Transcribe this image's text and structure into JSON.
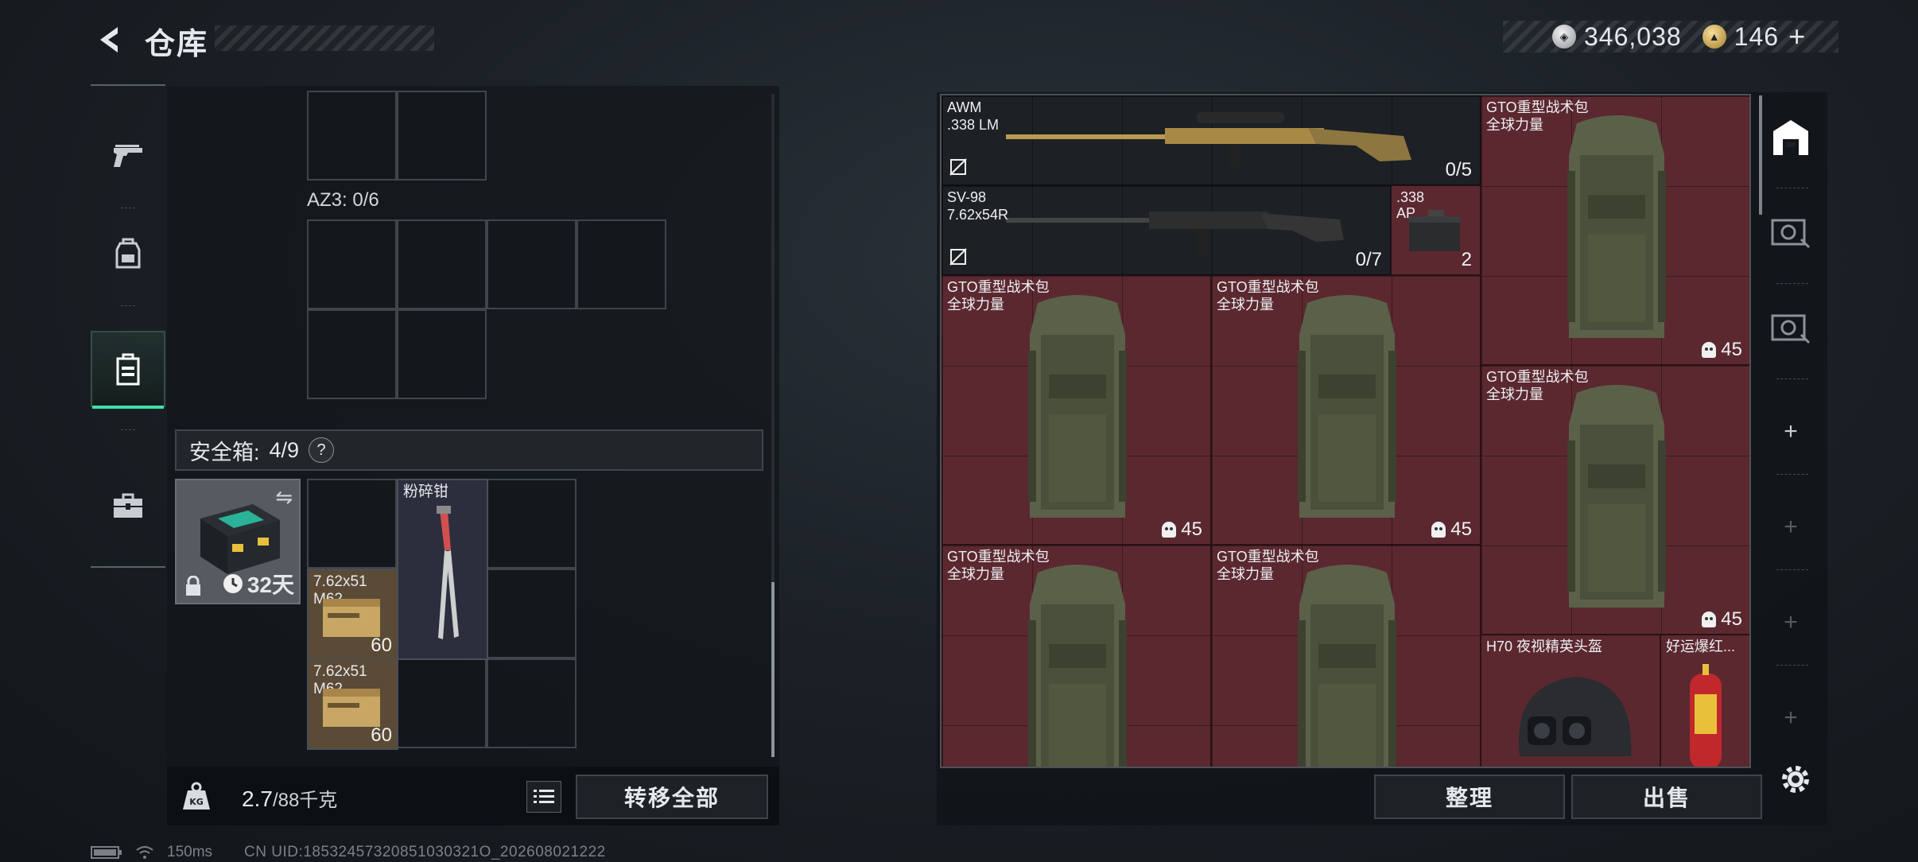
{
  "header": {
    "title": "仓库",
    "currency": [
      {
        "icon": "silver-coin-icon",
        "value": "346,038"
      },
      {
        "icon": "gold-coin-icon",
        "value": "146"
      }
    ],
    "add_label": "+"
  },
  "categories": [
    {
      "icon": "pistol-icon",
      "active": false
    },
    {
      "icon": "backpack-icon",
      "active": false
    },
    {
      "icon": "vest-icon",
      "active": true
    },
    {
      "icon": "briefcase-icon",
      "active": false
    }
  ],
  "left": {
    "az3_label": "AZ3: 0/6",
    "safe_label": "安全箱:",
    "safe_count": "4/9",
    "safe_help": "?",
    "safe_days": "32天",
    "items": [
      {
        "name": "粉碎钳",
        "count": ""
      },
      {
        "name": "7.62x51\nM62",
        "count": "60"
      },
      {
        "name": "7.62x51\nM62",
        "count": "60"
      }
    ],
    "weight_current": "2.7",
    "weight_max": "/88千克",
    "transfer_all": "转移全部"
  },
  "right": {
    "weapons": [
      {
        "name": "AWM",
        "ammo": ".338 LM",
        "count": "0/5"
      },
      {
        "name": "SV-98",
        "ammo": "7.62x54R",
        "count": "0/7"
      }
    ],
    "ammo_box": {
      "name": ".338\nAP",
      "count": "2"
    },
    "backpacks": [
      {
        "name": "GTO重型战术包",
        "sub": "全球力量",
        "count": "45"
      },
      {
        "name": "GTO重型战术包",
        "sub": "全球力量",
        "count": "45"
      },
      {
        "name": "GTO重型战术包",
        "sub": "全球力量",
        "count": "45"
      },
      {
        "name": "GTO重型战术包",
        "sub": "全球力量",
        "count": "45"
      },
      {
        "name": "GTO重型战术包",
        "sub": "全球力量",
        "count": ""
      },
      {
        "name": "GTO重型战术包",
        "sub": "全球力量",
        "count": ""
      }
    ],
    "helmet": {
      "name": "H70 夜视精英头盔"
    },
    "firecracker": {
      "name": "好运爆红..."
    },
    "sort_label": "整理",
    "sell_label": "出售"
  },
  "right_sidebar": {
    "plus": "+"
  },
  "status": {
    "ping": "150ms",
    "uid": "CN UID:18532457320851030321O_202608021222"
  }
}
